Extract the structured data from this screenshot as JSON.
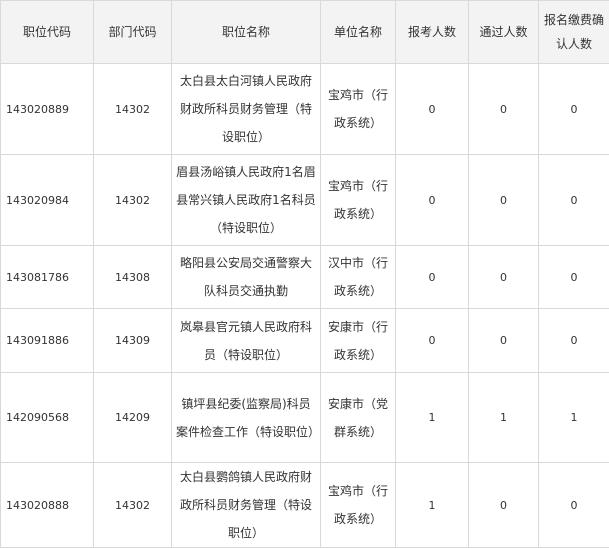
{
  "headers": [
    "职位代码",
    "部门代码",
    "职位名称",
    "单位名称",
    "报考人数",
    "通过人数",
    "报名缴费确认人数"
  ],
  "rows": [
    {
      "code": "143020889",
      "dept": "14302",
      "name": "太白县太白河镇人民政府财政所科员财务管理（特设职位）",
      "unit": "宝鸡市（行政系统）",
      "applied": "0",
      "passed": "0",
      "confirmed": "0"
    },
    {
      "code": "143020984",
      "dept": "14302",
      "name": "眉县汤峪镇人民政府1名眉县常兴镇人民政府1名科员（特设职位）",
      "unit": "宝鸡市（行政系统）",
      "applied": "0",
      "passed": "0",
      "confirmed": "0"
    },
    {
      "code": "143081786",
      "dept": "14308",
      "name": "略阳县公安局交通警察大队科员交通执勤",
      "unit": "汉中市（行政系统）",
      "applied": "0",
      "passed": "0",
      "confirmed": "0"
    },
    {
      "code": "143091886",
      "dept": "14309",
      "name": "岚皋县官元镇人民政府科员（特设职位）",
      "unit": "安康市（行政系统）",
      "applied": "0",
      "passed": "0",
      "confirmed": "0"
    },
    {
      "code": "142090568",
      "dept": "14209",
      "name": "镇坪县纪委(监察局)科员案件检查工作（特设职位）",
      "unit": "安康市（党群系统）",
      "applied": "1",
      "passed": "1",
      "confirmed": "1"
    },
    {
      "code": "143020888",
      "dept": "14302",
      "name": "太白县鹦鸽镇人民政府财政所科员财务管理（特设职位）",
      "unit": "宝鸡市（行政系统）",
      "applied": "1",
      "passed": "0",
      "confirmed": "0"
    }
  ]
}
